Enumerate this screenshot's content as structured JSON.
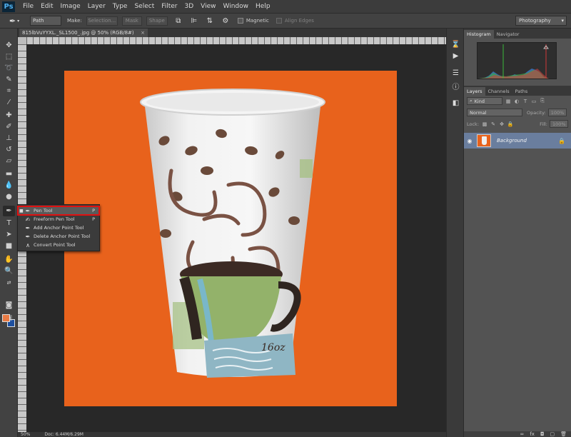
{
  "app": {
    "logo": "Ps"
  },
  "menu": [
    "File",
    "Edit",
    "Image",
    "Layer",
    "Type",
    "Select",
    "Filter",
    "3D",
    "View",
    "Window",
    "Help"
  ],
  "options": {
    "tool_mode": "Path",
    "make_label": "Make:",
    "selection_btn": "Selection...",
    "mask_btn": "Mask",
    "shape_btn": "Shape",
    "magnetic_label": "Magnetic",
    "align_edges_label": "Align Edges",
    "workspace": "Photography"
  },
  "document": {
    "tab_title": "815lbVuYYXL._SL1500_.jpg @ 50% (RGB/8#)",
    "tab_close": "×",
    "zoom": "50%",
    "doc_size": "Doc: 6.44M/6.29M"
  },
  "flyout": [
    {
      "label": "Pen Tool",
      "key": "P",
      "icon": "pen-icon",
      "selected": true
    },
    {
      "label": "Freeform Pen Tool",
      "key": "P",
      "icon": "freeform-pen-icon",
      "selected": false
    },
    {
      "label": "Add Anchor Point Tool",
      "key": "",
      "icon": "add-anchor-icon",
      "selected": false
    },
    {
      "label": "Delete Anchor Point Tool",
      "key": "",
      "icon": "delete-anchor-icon",
      "selected": false
    },
    {
      "label": "Convert Point Tool",
      "key": "",
      "icon": "convert-point-icon",
      "selected": false
    }
  ],
  "panels": {
    "top_tabs": [
      "Histogram",
      "Navigator"
    ],
    "layer_tabs": [
      "Layers",
      "Channels",
      "Paths"
    ],
    "kind_label": "Kind",
    "blend_mode": "Normal",
    "opacity_label": "Opacity:",
    "opacity_value": "100%",
    "lock_label": "Lock:",
    "fill_label": "Fill:",
    "fill_value": "100%",
    "layer_name": "Background"
  },
  "colors": {
    "foreground": "#e87a44",
    "background": "#1d4f9f",
    "artboard": "#e8621c",
    "highlight": "#e01010"
  },
  "cup": {
    "size_label": "16oz"
  }
}
